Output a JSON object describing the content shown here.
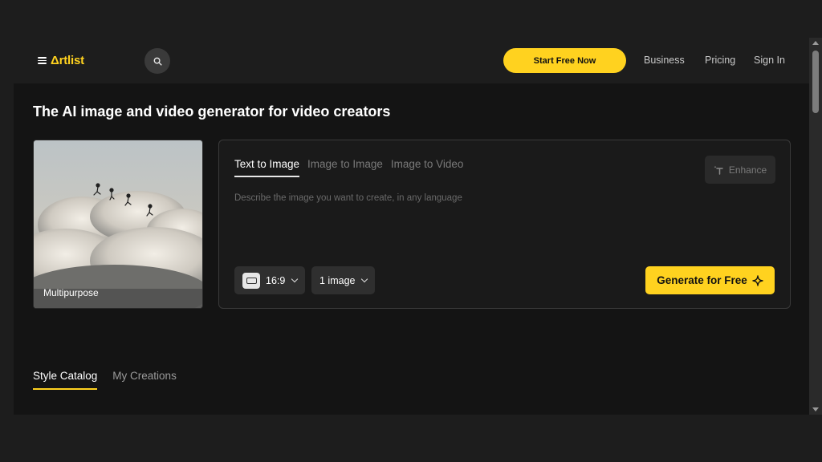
{
  "header": {
    "logo": "Δrtlist",
    "start_button": "Start Free Now",
    "nav": [
      "Business",
      "Pricing",
      "Sign In"
    ]
  },
  "page_title": "The AI image and video generator for video creators",
  "preset": {
    "label": "Multipurpose"
  },
  "generator": {
    "tabs": [
      "Text to Image",
      "Image to Image",
      "Image to Video"
    ],
    "active_tab": "Text to Image",
    "enhance_label": "Enhance",
    "prompt_placeholder": "Describe the image you want to create, in any language",
    "prompt_value": "",
    "aspect_ratio": "16:9",
    "image_count": "1 image",
    "generate_label": "Generate for Free"
  },
  "catalog_tabs": [
    "Style Catalog",
    "My Creations"
  ],
  "active_catalog_tab": "Style Catalog",
  "colors": {
    "accent": "#ffd21f",
    "background": "#141414",
    "panel": "#1a1a1a"
  },
  "icons": [
    "hamburger-icon",
    "search-icon",
    "enhance-icon",
    "aspect-ratio-icon",
    "chevron-down-icon",
    "sparkle-icon"
  ]
}
